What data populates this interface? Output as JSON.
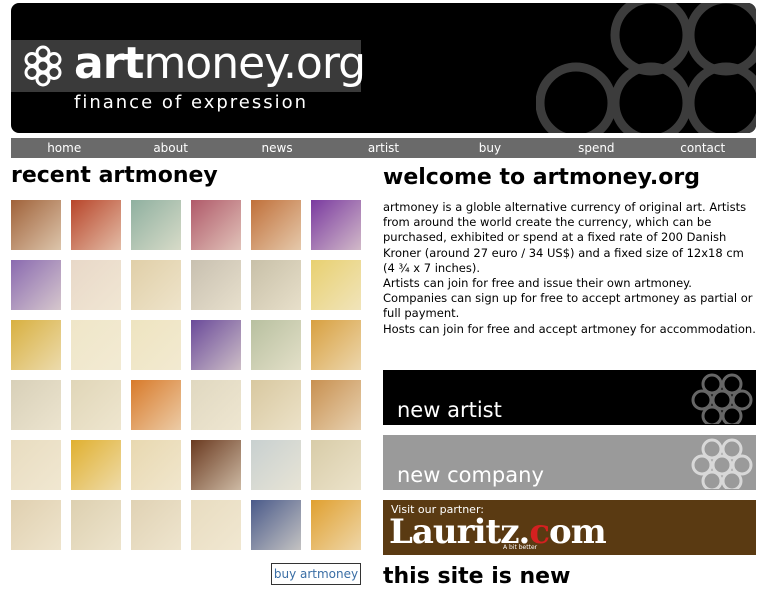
{
  "header": {
    "logo_bold": "art",
    "logo_rest": "money.org",
    "tagline": "finance of expression"
  },
  "nav": [
    "home",
    "about",
    "news",
    "artist",
    "buy",
    "spend",
    "contact"
  ],
  "recent": {
    "title": "recent artmoney",
    "buy_label": "buy artmoney",
    "tiles": [
      "#a0623a",
      "#b8452a",
      "#8fb0a0",
      "#b05a6a",
      "#c0703a",
      "#7a3aa0",
      "#8a6ab0",
      "#e8d8c8",
      "#e0cfa8",
      "#c8c0b0",
      "#c8c0a8",
      "#e8d070",
      "#d8b040",
      "#efe6c8",
      "#eee4c0",
      "#6a4a9a",
      "#b8c0a0",
      "#d8a040",
      "#d8d0b8",
      "#e0d6b8",
      "#d87a2a",
      "#e0d8c0",
      "#d8c8a0",
      "#c89050",
      "#e8dcc0",
      "#e0b030",
      "#e8d8b0",
      "#6a3a20",
      "#c8d0d0",
      "#d8cca8",
      "#e0d0b0",
      "#ddd0b0",
      "#e0d2b4",
      "#e8dcc0",
      "#4a5a8a",
      "#e0a030"
    ]
  },
  "welcome": {
    "title": "welcome to artmoney.org",
    "p1": "artmoney is a globle alternative currency of original art. Artists from around the world create the currency, which can be purchased, exhibited or spend at a fixed rate of 200 Danish Kroner (around 27 euro / 34 US$) and a fixed size of 12x18 cm (4 ¾ x 7 inches).",
    "p2": "Artists can join for free and issue their own artmoney.",
    "p3": "Companies can sign up for free to accept artmoney as partial or full payment.",
    "p4": "Hosts can join for free and accept artmoney for accommodation."
  },
  "banners": {
    "new_artist": "new artist",
    "new_company": "new company",
    "partner_visit": "Visit our partner:",
    "partner_name_a": "Lauritz.",
    "partner_name_c": "c",
    "partner_name_b": "om",
    "partner_small": "A bit better"
  },
  "footer_title": "this site is new",
  "colors": {
    "header_bg": "#000000",
    "nav_bg": "#6a6a6a",
    "new_company_bg": "#9a9a9a",
    "partner_bg": "#5a3a12",
    "link": "#3a6ea5"
  }
}
